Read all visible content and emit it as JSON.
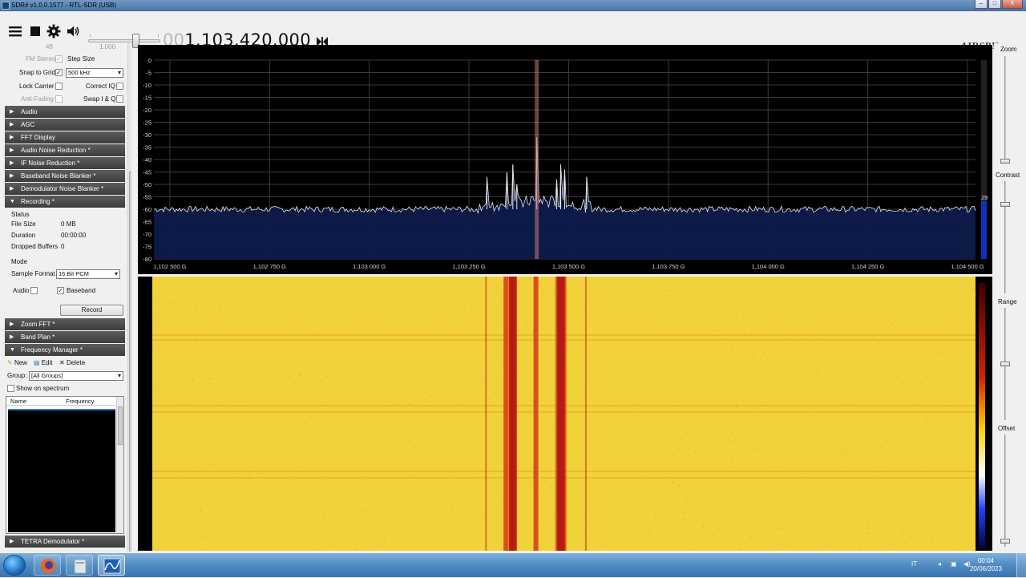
{
  "window": {
    "title": "SDR# v1.0.0.1577 - RTL-SDR (USB)",
    "buttons": [
      "–",
      "□",
      "X"
    ]
  },
  "toolbar": {
    "icons": [
      "menu-icon",
      "stop-icon",
      "gear-icon",
      "speaker-icon"
    ],
    "volume_level": 0.7,
    "frequency_leading": "00",
    "frequency": "1.103.420.000",
    "logo": "AIRSPY"
  },
  "left_panel": {
    "top_values": {
      "left": "48",
      "right": "1.000"
    },
    "fm_stereo": {
      "label": "FM Stereo",
      "checked": true,
      "enabled": false
    },
    "step_size_label": "Step Size",
    "snap_to_grid": {
      "label": "Snap to Grid",
      "checked": true
    },
    "step_size_value": "500 kHz",
    "lock_carrier": {
      "label": "Lock Carrier",
      "checked": false
    },
    "correct_iq": {
      "label": "Correct IQ",
      "checked": false
    },
    "anti_fading": {
      "label": "Anti-Fading",
      "checked": false,
      "enabled": false
    },
    "swap_iq": {
      "label": "Swap I & Q",
      "checked": false
    },
    "sections_top": [
      {
        "label": "Audio",
        "open": false
      },
      {
        "label": "AGC",
        "open": false
      },
      {
        "label": "FFT Display",
        "open": false
      },
      {
        "label": "Audio Noise Reduction *",
        "open": false
      },
      {
        "label": "IF Noise Reduction *",
        "open": false
      },
      {
        "label": "Baseband Noise Blanker *",
        "open": false
      },
      {
        "label": "Demodulator Noise Blanker *",
        "open": false
      },
      {
        "label": "Recording *",
        "open": true
      }
    ],
    "recording": {
      "status_header": "Status",
      "file_size_label": "File Size",
      "file_size_value": "0 MB",
      "duration_label": "Duration",
      "duration_value": "00:00:00",
      "dropped_label": "Dropped Buffers",
      "dropped_value": "0",
      "mode_header": "Mode",
      "sample_format_label": "Sample Format",
      "sample_format_value": "16 Bit PCM",
      "audio_label": "Audio",
      "audio_checked": false,
      "baseband_label": "Baseband",
      "baseband_checked": true,
      "record_button": "Record"
    },
    "sections_bottom": [
      {
        "label": "Zoom FFT *",
        "open": false
      },
      {
        "label": "Band Plan *",
        "open": false
      },
      {
        "label": "Frequency Manager *",
        "open": true
      }
    ],
    "freq_manager": {
      "new_label": "New",
      "edit_label": "Edit",
      "delete_label": "Delete",
      "group_label": "Group:",
      "group_value": "[All Groups]",
      "show_on_spectrum_label": "Show on spectrum",
      "show_on_spectrum_checked": false,
      "columns": [
        "Name",
        "Frequency"
      ]
    },
    "last_section": {
      "label": "TETRA Demodulator *",
      "open": false
    }
  },
  "spectrum": {
    "y_ticks": [
      "0",
      "-5",
      "-10",
      "-15",
      "-20",
      "-25",
      "-30",
      "-35",
      "-40",
      "-45",
      "-50",
      "-55",
      "-60",
      "-65",
      "-70",
      "-75",
      "-80"
    ],
    "x_ticks": [
      "1,102 500 G",
      "1,102 750 G",
      "1,103 000 G",
      "1,103 250 G",
      "1,103 500 G",
      "1,103 750 G",
      "1,104 000 G",
      "1,104 250 G",
      "1,104 500 G"
    ],
    "level_readout": "29",
    "colors": {
      "background": "#000000",
      "fill": "#0e1a4a",
      "trace": "#e8e8e8",
      "grid": "#3a3a3a",
      "marker": "#c47a7a"
    }
  },
  "waterfall": {
    "colors": {
      "base": "#f2d23a",
      "signal": "#d8401a",
      "hot": "#b01010"
    }
  },
  "right_rail": {
    "labels": [
      "Zoom",
      "Contrast",
      "Range",
      "Offset"
    ]
  },
  "taskbar": {
    "language": "IT",
    "time": "00:04",
    "date": "20/06/2023",
    "apps": [
      "firefox-icon",
      "explorer-icon",
      "sdrsharp-icon"
    ]
  },
  "chart_data": {
    "type": "line",
    "title": "",
    "xlabel": "",
    "ylabel": "",
    "x_tick_labels": [
      "1,102 500 G",
      "1,102 750 G",
      "1,103 000 G",
      "1,103 250 G",
      "1,103 500 G",
      "1,103 750 G",
      "1,104 000 G",
      "1,104 250 G",
      "1,104 500 G"
    ],
    "x_tick_values_ghz": [
      1.1025,
      1.10275,
      1.103,
      1.10325,
      1.1035,
      1.10375,
      1.104,
      1.10425,
      1.1045
    ],
    "xlim_ghz": [
      1.10246,
      1.10452
    ],
    "ylim": [
      -80,
      0
    ],
    "grid": true,
    "noise_floor_db": -60,
    "center_marker_ghz": 1.10342,
    "series": [
      {
        "peaks": [
          {
            "x": 1.103295,
            "y": -47
          },
          {
            "x": 1.103345,
            "y": -45
          },
          {
            "x": 1.10336,
            "y": -42
          },
          {
            "x": 1.10337,
            "y": -50
          },
          {
            "x": 1.10342,
            "y": -31
          },
          {
            "x": 1.10347,
            "y": -48
          },
          {
            "x": 1.10348,
            "y": -42
          },
          {
            "x": 1.10349,
            "y": -44
          },
          {
            "x": 1.103545,
            "y": -47
          }
        ]
      }
    ]
  }
}
